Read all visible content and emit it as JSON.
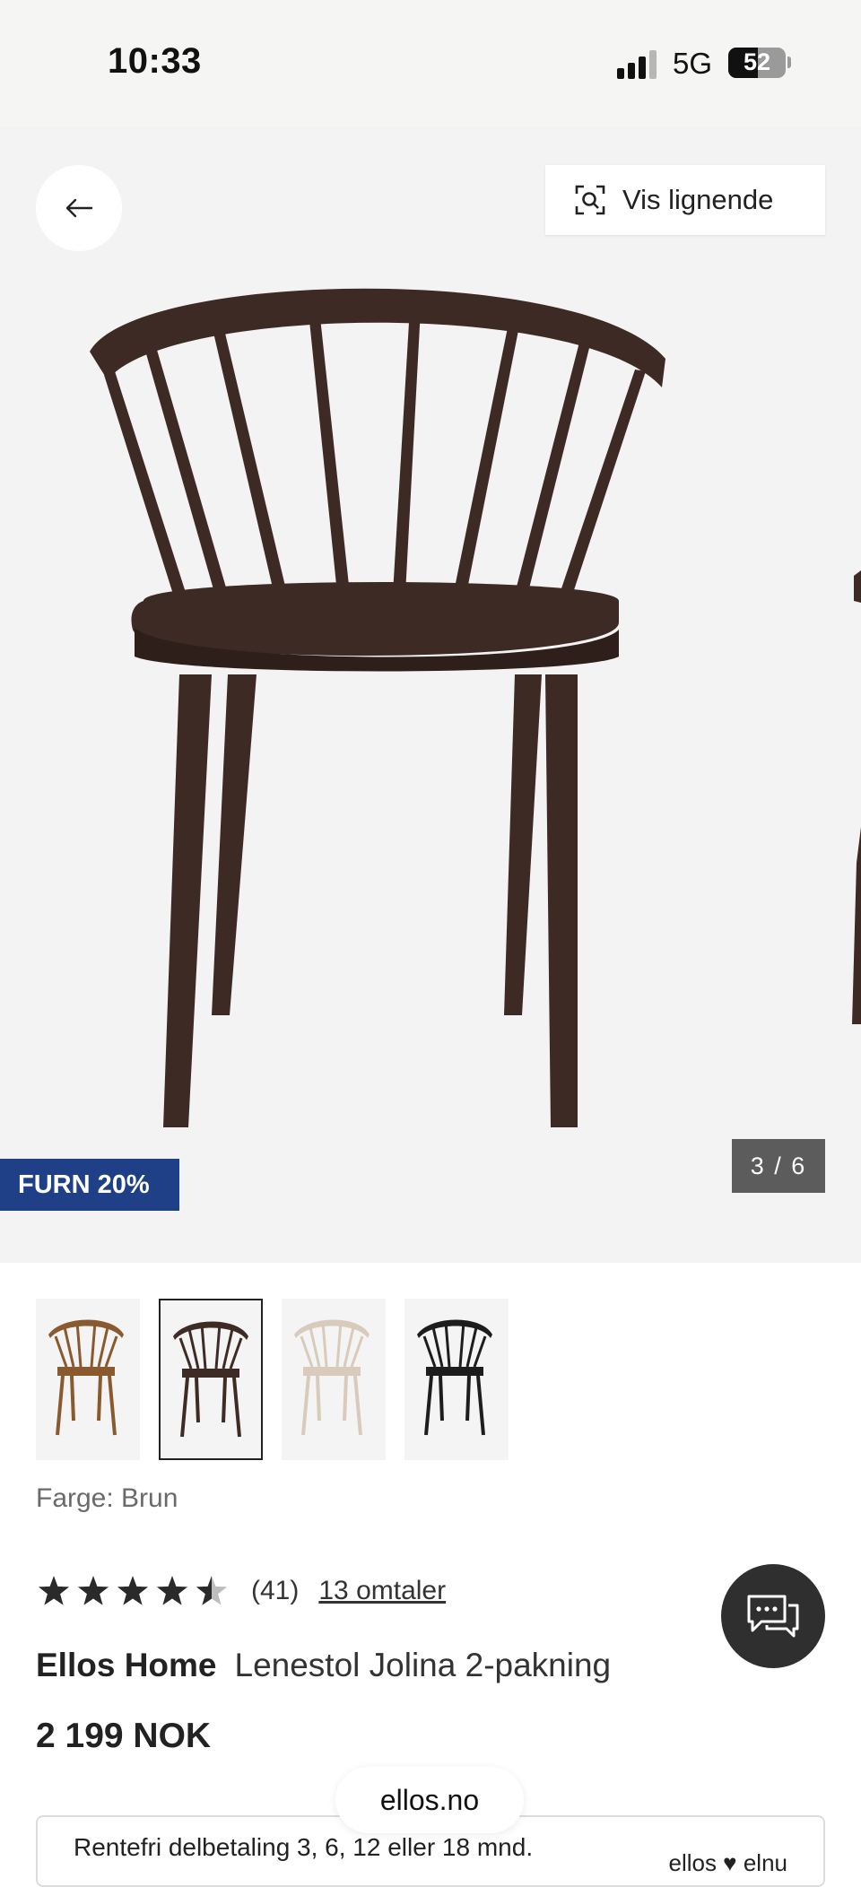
{
  "status_bar": {
    "time": "10:33",
    "network": "5G",
    "battery": "52",
    "battery_level": 0.52
  },
  "gallery": {
    "back_icon": "arrow-left-icon",
    "similar_button": {
      "label": "Vis lignende",
      "icon": "visual-search-icon"
    },
    "promo_badge": "FURN 20%",
    "image_counter": "3 / 6",
    "chair_color": "#3e2a24"
  },
  "variants": [
    {
      "color": "#8a5a2f",
      "selected": false
    },
    {
      "color": "#3f2b25",
      "selected": true
    },
    {
      "color": "#d8cbbb",
      "selected": false
    },
    {
      "color": "#1d1d1d",
      "selected": false
    }
  ],
  "color_selection": "Farge: Brun",
  "rating": {
    "stars": 4.5,
    "count": "(41)",
    "reviews_link": "13 omtaler"
  },
  "product": {
    "brand": "Ellos Home",
    "name": "Lenestol Jolina 2-pakning",
    "price": "2 199 NOK"
  },
  "browser_url": "ellos.no",
  "financing": {
    "text": "Rentefri delbetaling 3, 6, 12 eller 18 mnd.",
    "logo": "ellos ♥ elnu"
  },
  "chat_icon": "chat-bubbles-icon",
  "colors": {
    "promo_blue": "#1f3f86",
    "chat_bg": "#2f2f2f"
  }
}
